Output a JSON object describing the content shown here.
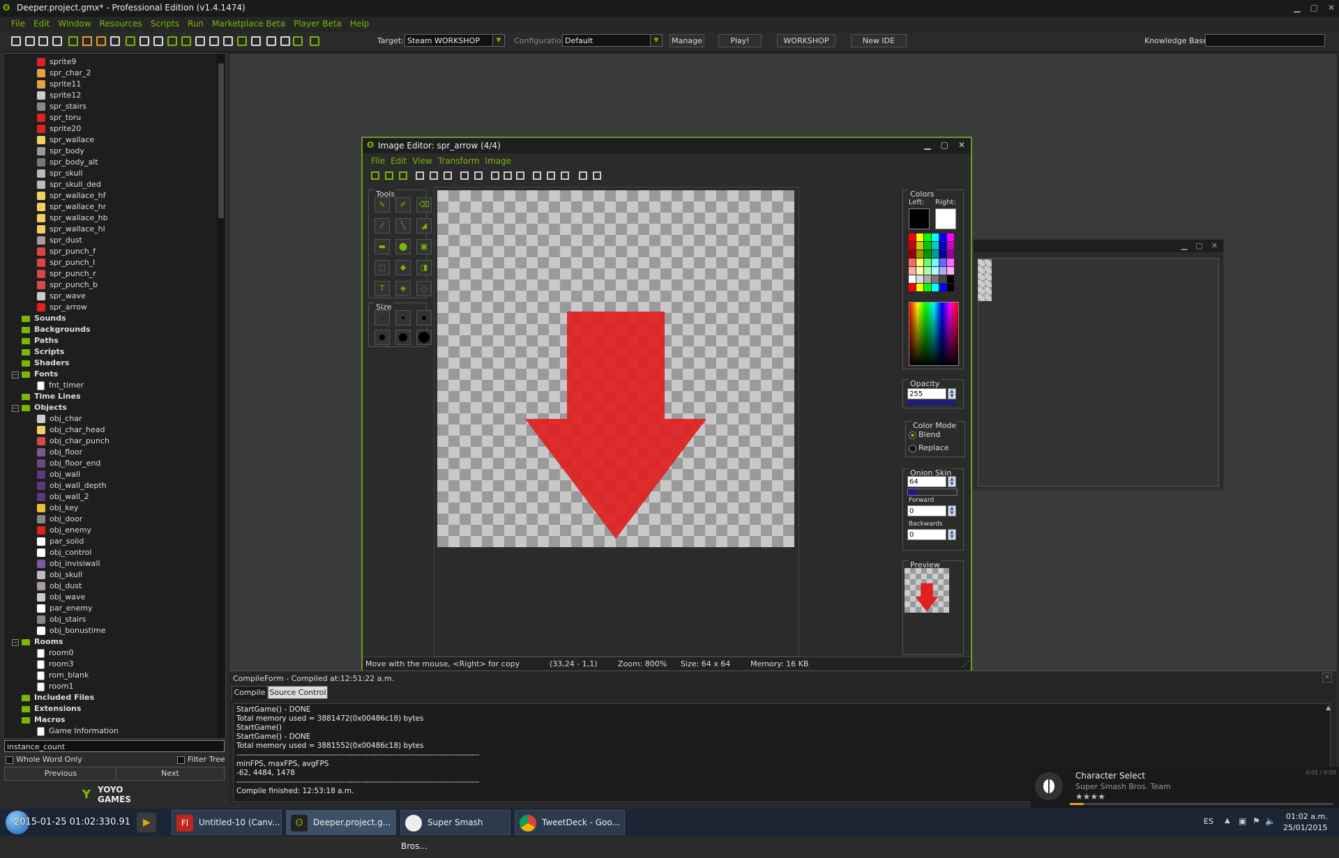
{
  "app": {
    "title": "Deeper.project.gmx*  -  Professional Edition (v1.4.1474)",
    "menu": [
      "File",
      "Edit",
      "Window",
      "Resources",
      "Scripts",
      "Run",
      "Marketplace Beta",
      "Player Beta",
      "Help"
    ]
  },
  "toolbar": {
    "target_label": "Target:",
    "target_value": "Steam WORKSHOP",
    "config_label": "Configuration:",
    "config_value": "Default",
    "manage": "Manage",
    "play": "Play!",
    "workshop": "WORKSHOP",
    "new_ide": "New IDE",
    "knowledge_label": "Knowledge Base:",
    "knowledge_value": ""
  },
  "tree": {
    "items": [
      {
        "label": "sprite9",
        "kind": "sprite",
        "color": "#d22"
      },
      {
        "label": "spr_char_2",
        "kind": "sprite",
        "color": "#e8a040"
      },
      {
        "label": "sprite11",
        "kind": "sprite",
        "color": "#e8a040"
      },
      {
        "label": "sprite12",
        "kind": "sprite",
        "color": "#ccc"
      },
      {
        "label": "spr_stairs",
        "kind": "sprite",
        "color": "#888"
      },
      {
        "label": "spr_toru",
        "kind": "sprite",
        "color": "#d22"
      },
      {
        "label": "sprite20",
        "kind": "sprite",
        "color": "#d22"
      },
      {
        "label": "spr_wallace",
        "kind": "sprite",
        "color": "#f0d060"
      },
      {
        "label": "spr_body",
        "kind": "sprite",
        "color": "#999"
      },
      {
        "label": "spr_body_alt",
        "kind": "sprite",
        "color": "#777"
      },
      {
        "label": "spr_skull",
        "kind": "sprite",
        "color": "#bbb"
      },
      {
        "label": "spr_skull_ded",
        "kind": "sprite",
        "color": "#bbb"
      },
      {
        "label": "spr_wallace_hf",
        "kind": "sprite",
        "color": "#f0d060"
      },
      {
        "label": "spr_wallace_hr",
        "kind": "sprite",
        "color": "#f0d060"
      },
      {
        "label": "spr_wallace_hb",
        "kind": "sprite",
        "color": "#f0d060"
      },
      {
        "label": "spr_wallace_hl",
        "kind": "sprite",
        "color": "#f0d060"
      },
      {
        "label": "spr_dust",
        "kind": "sprite",
        "color": "#a99"
      },
      {
        "label": "spr_punch_f",
        "kind": "sprite",
        "color": "#d44"
      },
      {
        "label": "spr_punch_l",
        "kind": "sprite",
        "color": "#d44"
      },
      {
        "label": "spr_punch_r",
        "kind": "sprite",
        "color": "#d44"
      },
      {
        "label": "spr_punch_b",
        "kind": "sprite",
        "color": "#d44"
      },
      {
        "label": "spr_wave",
        "kind": "sprite",
        "color": "#ccc"
      },
      {
        "label": "spr_arrow",
        "kind": "sprite",
        "color": "#d22"
      },
      {
        "label": "Sounds",
        "kind": "folder"
      },
      {
        "label": "Backgrounds",
        "kind": "folder"
      },
      {
        "label": "Paths",
        "kind": "folder"
      },
      {
        "label": "Scripts",
        "kind": "folder"
      },
      {
        "label": "Shaders",
        "kind": "folder"
      },
      {
        "label": "Fonts",
        "kind": "folder-open"
      },
      {
        "label": "fnt_timer",
        "kind": "doc"
      },
      {
        "label": "Time Lines",
        "kind": "folder"
      },
      {
        "label": "Objects",
        "kind": "folder-open"
      },
      {
        "label": "obj_char",
        "kind": "sprite",
        "color": "#ccc"
      },
      {
        "label": "obj_char_head",
        "kind": "sprite",
        "color": "#f0d060"
      },
      {
        "label": "obj_char_punch",
        "kind": "sprite",
        "color": "#d44"
      },
      {
        "label": "obj_floor",
        "kind": "sprite",
        "color": "#7a5a8a"
      },
      {
        "label": "obj_floor_end",
        "kind": "sprite",
        "color": "#6a4a7a"
      },
      {
        "label": "obj_wall",
        "kind": "sprite",
        "color": "#5a3a7a"
      },
      {
        "label": "obj_wall_depth",
        "kind": "sprite",
        "color": "#5a3a7a"
      },
      {
        "label": "obj_wall_2",
        "kind": "sprite",
        "color": "#5a3a7a"
      },
      {
        "label": "obj_key",
        "kind": "sprite",
        "color": "#e8c030"
      },
      {
        "label": "obj_door",
        "kind": "sprite",
        "color": "#888"
      },
      {
        "label": "obj_enemy",
        "kind": "sprite",
        "color": "#d22"
      },
      {
        "label": "par_solid",
        "kind": "sprite",
        "color": "#fff"
      },
      {
        "label": "obj_control",
        "kind": "sprite",
        "color": "#fff"
      },
      {
        "label": "obj_invisiwall",
        "kind": "sprite",
        "color": "#7a5aa0"
      },
      {
        "label": "obj_skull",
        "kind": "sprite",
        "color": "#bbb"
      },
      {
        "label": "obj_dust",
        "kind": "sprite",
        "color": "#a99"
      },
      {
        "label": "obj_wave",
        "kind": "sprite",
        "color": "#ccc"
      },
      {
        "label": "par_enemy",
        "kind": "sprite",
        "color": "#fff"
      },
      {
        "label": "obj_stairs",
        "kind": "sprite",
        "color": "#888"
      },
      {
        "label": "obj_bonustime",
        "kind": "sprite",
        "color": "#fff"
      },
      {
        "label": "Rooms",
        "kind": "folder-open"
      },
      {
        "label": "room0",
        "kind": "doc"
      },
      {
        "label": "room3",
        "kind": "doc"
      },
      {
        "label": "rom_blank",
        "kind": "doc"
      },
      {
        "label": "room1",
        "kind": "doc"
      },
      {
        "label": "Included Files",
        "kind": "folder"
      },
      {
        "label": "Extensions",
        "kind": "folder"
      },
      {
        "label": "Macros",
        "kind": "folder"
      },
      {
        "label": "Game Information",
        "kind": "doc"
      }
    ],
    "search_value": "instance_count",
    "whole_word": "Whole Word Only",
    "filter_tree": "Filter Tree",
    "previous": "Previous",
    "next": "Next",
    "logo_line1": "YOYO",
    "logo_line2": "GAMES"
  },
  "image_editor": {
    "title": "Image Editor: spr_arrow (4/4)",
    "menu": [
      "File",
      "Edit",
      "View",
      "Transform",
      "Image"
    ],
    "tools_label": "Tools",
    "size_label": "Size",
    "colors_label": "Colors",
    "left_label": "Left:",
    "right_label": "Right:",
    "opacity_label": "Opacity",
    "opacity_value": "255",
    "color_mode_label": "Color Mode",
    "blend_label": "Blend",
    "replace_label": "Replace",
    "onion_label": "Onion Skin",
    "onion_value": "64",
    "forward_label": "Forward",
    "forward_value": "0",
    "backwards_label": "Backwards",
    "backwards_value": "0",
    "preview_label": "Preview",
    "status": {
      "hint": "Move with the mouse, <Right> for copy",
      "coords": "(33,24 - 1,1)",
      "zoom": "Zoom: 800%",
      "size": "Size: 64 x 64",
      "memory": "Memory: 16 KB"
    },
    "arrow_color": "#e02020"
  },
  "compile": {
    "header": "CompileForm - Compiled at:12:51:22 a.m.",
    "tab_compile": "Compile",
    "tab_source": "Source Control",
    "lines": [
      "StartGame() - DONE",
      "Total memory used = 3881472(0x00486c18) bytes",
      "StartGame()",
      "StartGame() - DONE",
      "Total memory used = 3881552(0x00486c18) bytes",
      "--------------------------------------------------------------------------------------------",
      "minFPS, maxFPS, avgFPS",
      "-62, 4484, 1478",
      "--------------------------------------------------------------------------------------------",
      "Compile finished: 12:53:18 a.m."
    ]
  },
  "notification": {
    "title": "Character Select",
    "subtitle": "Super Smash Bros. Team",
    "time": "0:01 / 0:05",
    "stars": "★★★★"
  },
  "taskbar": {
    "overlay_time": "2015-01-25 01:02:330.91",
    "tasks": [
      "Untitled-10 (Canv...",
      "Deeper.project.g...",
      "Super Smash Bros...",
      "TweetDeck - Goo..."
    ],
    "lang": "ES",
    "clock_time": "01:02 a.m.",
    "clock_date": "25/01/2015"
  }
}
